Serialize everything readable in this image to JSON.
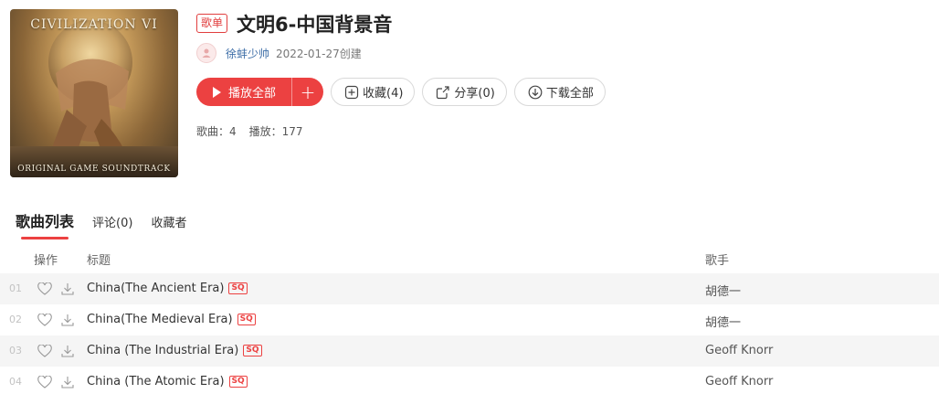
{
  "cover": {
    "title": "CIVILIZATION VI",
    "subtitle": "ORIGINAL GAME SOUNDTRACK"
  },
  "playlist": {
    "type_badge": "歌单",
    "title": "文明6-中国背景音",
    "creator": "徐蚌少帅",
    "created": "2022-01-27创建"
  },
  "actions": {
    "play_all": "播放全部",
    "add": "+",
    "collect": "收藏(4)",
    "share": "分享(0)",
    "download_all": "下载全部"
  },
  "stats": {
    "songs": "歌曲：4",
    "plays": "播放：177"
  },
  "tabs": {
    "songs": "歌曲列表",
    "comments": "评论(0)",
    "collectors": "收藏者"
  },
  "table": {
    "headers": {
      "ops": "操作",
      "title": "标题",
      "artist": "歌手"
    },
    "rows": [
      {
        "index": "01",
        "title": "China(The Ancient Era)",
        "quality": "SQ",
        "artist": "胡德一"
      },
      {
        "index": "02",
        "title": "China(The Medieval Era)",
        "quality": "SQ",
        "artist": "胡德一"
      },
      {
        "index": "03",
        "title": "China (The Industrial Era)",
        "quality": "SQ",
        "artist": "Geoff Knorr"
      },
      {
        "index": "04",
        "title": "China (The Atomic Era)",
        "quality": "SQ",
        "artist": "Geoff Knorr"
      }
    ]
  },
  "colors": {
    "accent": "#ec4141",
    "link": "#3f6fa8",
    "row_stripe": "#f5f5f5"
  },
  "icons": [
    "play-icon",
    "plus-icon",
    "collect-icon",
    "share-icon",
    "download-icon",
    "heart-icon"
  ]
}
